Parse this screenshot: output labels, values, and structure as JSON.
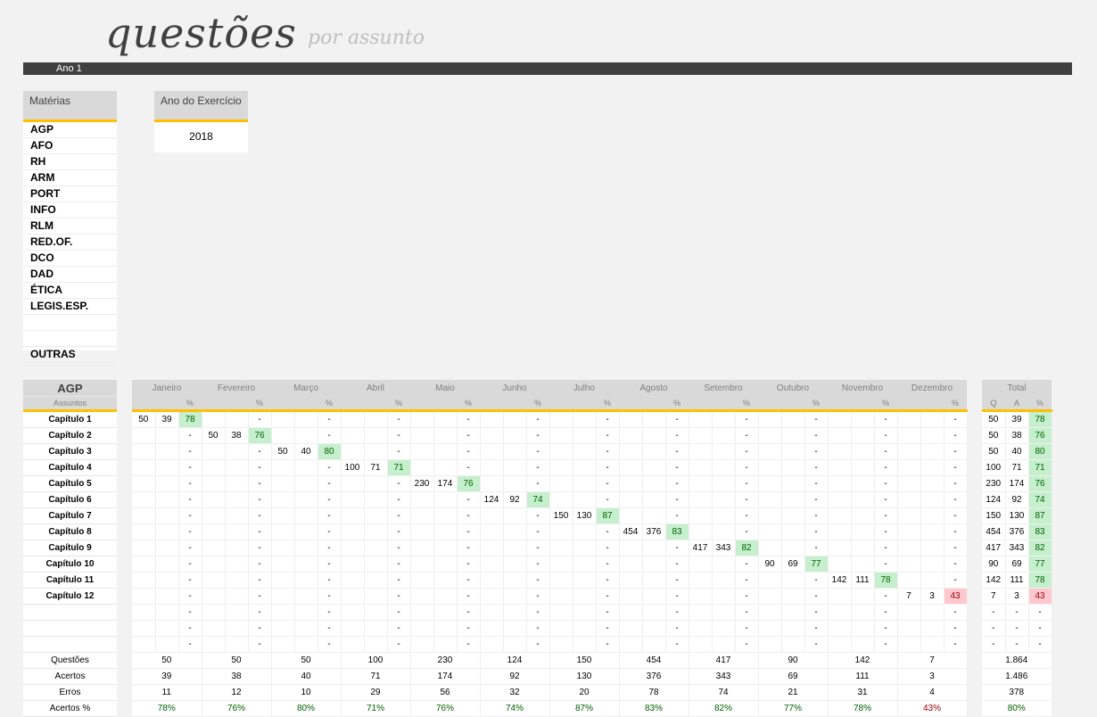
{
  "header": {
    "title": "questões",
    "subtitle": "por assunto"
  },
  "year_bar": "Ano 1",
  "materias": {
    "title": "Matérias",
    "items": [
      "AGP",
      "AFO",
      "RH",
      "ARM",
      "PORT",
      "INFO",
      "RLM",
      "RED.OF.",
      "DCO",
      "DAD",
      "ÉTICA",
      "LEGIS.ESP.",
      "",
      "",
      "OUTRAS"
    ]
  },
  "ano_exercicio": {
    "title": "Ano do Exercício",
    "value": "2018"
  },
  "table": {
    "subject": "AGP",
    "assuntos_label": "Assuntos",
    "months": [
      "Janeiro",
      "Fevereiro",
      "Março",
      "Abril",
      "Maio",
      "Junho",
      "Julho",
      "Agosto",
      "Setembro",
      "Outubro",
      "Novembro",
      "Dezembro"
    ],
    "total_label": "Total",
    "sub_headers": [
      "Q",
      "A",
      "%"
    ],
    "rows": [
      {
        "label": "Capítulo 1",
        "month": 0,
        "q": "50",
        "a": "39",
        "p": "78",
        "tq": "50",
        "ta": "39",
        "tp": "78",
        "color": "g"
      },
      {
        "label": "Capítulo 2",
        "month": 1,
        "q": "50",
        "a": "38",
        "p": "76",
        "tq": "50",
        "ta": "38",
        "tp": "76",
        "color": "g"
      },
      {
        "label": "Capítulo 3",
        "month": 2,
        "q": "50",
        "a": "40",
        "p": "80",
        "tq": "50",
        "ta": "40",
        "tp": "80",
        "color": "g"
      },
      {
        "label": "Capítulo 4",
        "month": 3,
        "q": "100",
        "a": "71",
        "p": "71",
        "tq": "100",
        "ta": "71",
        "tp": "71",
        "color": "g"
      },
      {
        "label": "Capítulo 5",
        "month": 4,
        "q": "230",
        "a": "174",
        "p": "76",
        "tq": "230",
        "ta": "174",
        "tp": "76",
        "color": "g"
      },
      {
        "label": "Capítulo 6",
        "month": 5,
        "q": "124",
        "a": "92",
        "p": "74",
        "tq": "124",
        "ta": "92",
        "tp": "74",
        "color": "g"
      },
      {
        "label": "Capítulo 7",
        "month": 6,
        "q": "150",
        "a": "130",
        "p": "87",
        "tq": "150",
        "ta": "130",
        "tp": "87",
        "color": "g"
      },
      {
        "label": "Capítulo 8",
        "month": 7,
        "q": "454",
        "a": "376",
        "p": "83",
        "tq": "454",
        "ta": "376",
        "tp": "83",
        "color": "g"
      },
      {
        "label": "Capítulo 9",
        "month": 8,
        "q": "417",
        "a": "343",
        "p": "82",
        "tq": "417",
        "ta": "343",
        "tp": "82",
        "color": "g"
      },
      {
        "label": "Capítulo 10",
        "month": 9,
        "q": "90",
        "a": "69",
        "p": "77",
        "tq": "90",
        "ta": "69",
        "tp": "77",
        "color": "g"
      },
      {
        "label": "Capítulo 11",
        "month": 10,
        "q": "142",
        "a": "111",
        "p": "78",
        "tq": "142",
        "ta": "111",
        "tp": "78",
        "color": "g"
      },
      {
        "label": "Capítulo 12",
        "month": 11,
        "q": "7",
        "a": "3",
        "p": "43",
        "tq": "7",
        "ta": "3",
        "tp": "43",
        "color": "r"
      },
      {
        "label": "",
        "month": -1,
        "tq": "-",
        "ta": "-",
        "tp": "-"
      },
      {
        "label": "",
        "month": -1,
        "tq": "-",
        "ta": "-",
        "tp": "-"
      },
      {
        "label": "",
        "month": -1,
        "tq": "-",
        "ta": "-",
        "tp": "-"
      }
    ],
    "dash": "-",
    "summary": [
      {
        "label": "Questões",
        "values": [
          "50",
          "50",
          "50",
          "100",
          "230",
          "124",
          "150",
          "454",
          "417",
          "90",
          "142",
          "7"
        ],
        "total": "1.864"
      },
      {
        "label": "Acertos",
        "values": [
          "39",
          "38",
          "40",
          "71",
          "174",
          "92",
          "130",
          "376",
          "343",
          "69",
          "111",
          "3"
        ],
        "total": "1.486"
      },
      {
        "label": "Erros",
        "values": [
          "11",
          "12",
          "10",
          "29",
          "56",
          "32",
          "20",
          "78",
          "74",
          "21",
          "31",
          "4"
        ],
        "total": "378"
      },
      {
        "label": "Acertos %",
        "values": [
          "78%",
          "76%",
          "80%",
          "71%",
          "76%",
          "74%",
          "87%",
          "83%",
          "82%",
          "77%",
          "78%",
          "43%"
        ],
        "total": "80%",
        "colors": [
          "g",
          "g",
          "g",
          "g",
          "g",
          "g",
          "g",
          "g",
          "g",
          "g",
          "g",
          "r"
        ],
        "total_color": "g"
      }
    ]
  }
}
